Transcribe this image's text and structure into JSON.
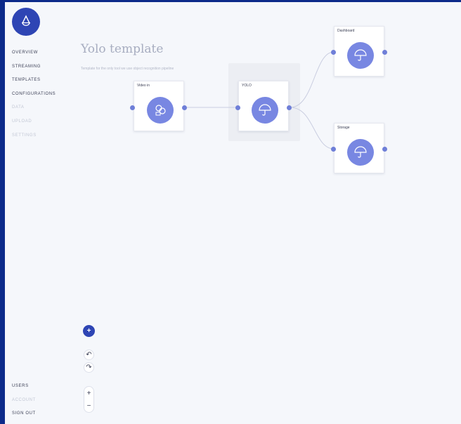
{
  "sidebar": {
    "logo": "drop-icon",
    "items": [
      {
        "label": "OVERVIEW",
        "enabled": true
      },
      {
        "label": "STREAMING",
        "enabled": true
      },
      {
        "label": "TEMPLATES",
        "enabled": true
      },
      {
        "label": "CONFIGURATIONS",
        "enabled": true
      },
      {
        "label": "DATA",
        "enabled": false
      },
      {
        "label": "UPLOAD",
        "enabled": false
      },
      {
        "label": "SETTINGS",
        "enabled": false
      }
    ],
    "bottom_items": [
      {
        "label": "USERS",
        "enabled": true
      },
      {
        "label": "ACCOUNT",
        "enabled": false
      },
      {
        "label": "SIGN OUT",
        "enabled": true
      }
    ]
  },
  "header": {
    "title": "Yolo template",
    "description": "Template for the only tool we use object recognition pipeline"
  },
  "graph": {
    "nodes": {
      "video_in": {
        "label": "Video in",
        "icon": "camera-icon"
      },
      "yolo": {
        "label": "YOLO",
        "icon": "umbrella-icon"
      },
      "dashboard": {
        "label": "Dashboard",
        "icon": "umbrella-icon"
      },
      "storage": {
        "label": "Storage",
        "icon": "umbrella-icon"
      }
    }
  },
  "controls": {
    "add": "+",
    "undo": "↶",
    "redo": "↷",
    "zoom_in": "+",
    "zoom_out": "−"
  },
  "colors": {
    "accent": "#2e45b4",
    "node_circle": "#7887e2",
    "port": "#6f7fd8",
    "background": "#f5f7fb"
  }
}
